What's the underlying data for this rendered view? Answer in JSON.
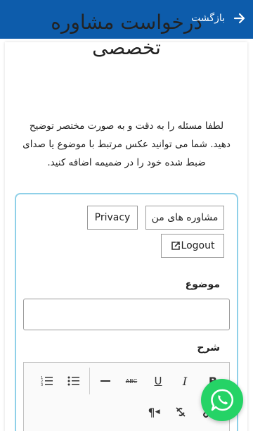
{
  "header": {
    "back_label": "بازگشت",
    "bg_color": "#0d5cab",
    "back_icon": "arrow-right-icon"
  },
  "page": {
    "title": "درخواست مشاوره تخصصی",
    "description": "لطفا مسئله را به دقت و به صورت مختصر توضیح دهید. شما می توانید عکس مرتبط با موضوع یا صدای ضبط شده خود را در ضمیمه اضافه کنید."
  },
  "card": {
    "my_consults_label": "مشاوره های من",
    "privacy_label": "Privacy",
    "logout_label": "Logout",
    "logout_icon": "external-link-icon",
    "border_color": "#8fd0e8"
  },
  "form": {
    "subject_label": "موضوع",
    "subject_value": "",
    "description_label": "شرح"
  },
  "editor": {
    "toolbar_row1": [
      "ordered-list-icon",
      "bulleted-list-icon",
      "horizontal-rule-icon",
      "strikethrough-icon",
      "underline-icon",
      "italic-icon",
      "bold-icon"
    ],
    "toolbar_row2": [
      "paragraph-direction-icon",
      "unlink-icon",
      "link-icon"
    ],
    "strike_glyph": "ABC",
    "underline_glyph": "U",
    "italic_glyph": "I",
    "bold_glyph": "B",
    "paragraph_glyph": "¶"
  },
  "floating": {
    "whatsapp_icon": "whatsapp-icon",
    "color": "#25d366"
  }
}
